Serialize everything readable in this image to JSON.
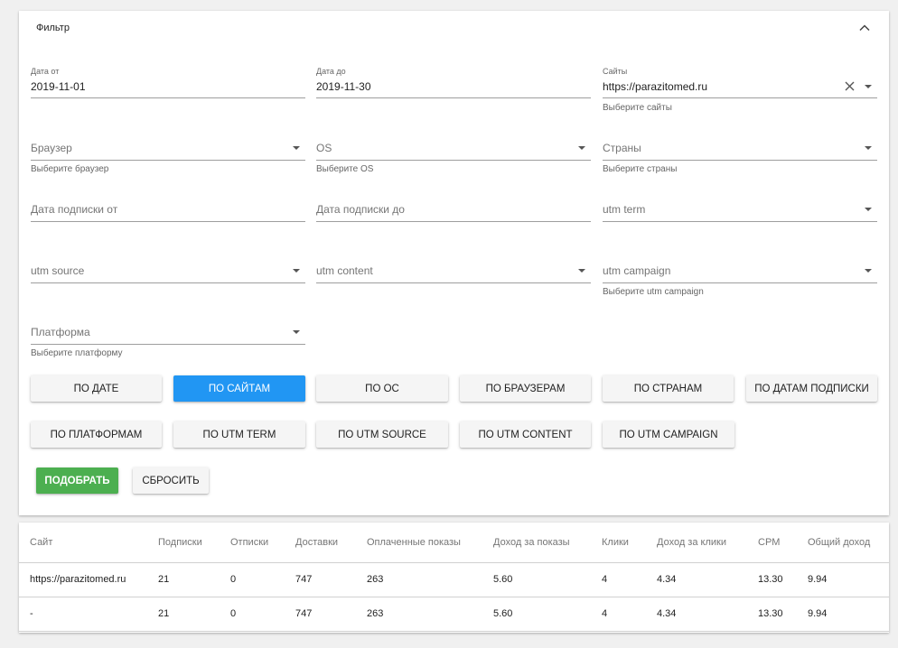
{
  "filter": {
    "title": "Фильтр",
    "date_from": {
      "label": "Дата от",
      "value": "2019-11-01"
    },
    "date_to": {
      "label": "Дата до",
      "value": "2019-11-30"
    },
    "sites": {
      "label": "Сайты",
      "value": "https://parazitomed.ru",
      "hint": "Выберите сайты"
    },
    "browser": {
      "placeholder": "Браузер",
      "hint": "Выберите браузер"
    },
    "os": {
      "placeholder": "OS",
      "hint": "Выберите OS"
    },
    "countries": {
      "placeholder": "Страны",
      "hint": "Выберите страны"
    },
    "sub_date_from": {
      "placeholder": "Дата подписки от"
    },
    "sub_date_to": {
      "placeholder": "Дата подписки до"
    },
    "utm_term": {
      "placeholder": "utm term"
    },
    "utm_source": {
      "placeholder": "utm source"
    },
    "utm_content": {
      "placeholder": "utm content"
    },
    "utm_campaign": {
      "placeholder": "utm campaign",
      "hint": "Выберите utm campaign"
    },
    "platform": {
      "placeholder": "Платформа",
      "hint": "Выберите платформу"
    }
  },
  "group_buttons": [
    {
      "label": "По дате",
      "active": false
    },
    {
      "label": "По сайтам",
      "active": true
    },
    {
      "label": "По ОС",
      "active": false
    },
    {
      "label": "По браузерам",
      "active": false
    },
    {
      "label": "По странам",
      "active": false
    },
    {
      "label": "По датам подписки",
      "active": false
    },
    {
      "label": "По платформам",
      "active": false
    },
    {
      "label": "По UTM term",
      "active": false
    },
    {
      "label": "По UTM source",
      "active": false
    },
    {
      "label": "По UTM content",
      "active": false
    },
    {
      "label": "По UTM campaign",
      "active": false
    }
  ],
  "actions": {
    "apply_label": "Подобрать",
    "reset_label": "Сбросить"
  },
  "colors": {
    "active": "#2196f3",
    "apply": "#4caf50"
  },
  "table": {
    "columns": [
      "Сайт",
      "Подписки",
      "Отписки",
      "Доставки",
      "Оплаченные показы",
      "Доход за показы",
      "Клики",
      "Доход за клики",
      "CPM",
      "Общий доход"
    ],
    "rows": [
      [
        "https://parazitomed.ru",
        "21",
        "0",
        "747",
        "263",
        "5.60",
        "4",
        "4.34",
        "13.30",
        "9.94"
      ],
      [
        "-",
        "21",
        "0",
        "747",
        "263",
        "5.60",
        "4",
        "4.34",
        "13.30",
        "9.94"
      ]
    ]
  }
}
